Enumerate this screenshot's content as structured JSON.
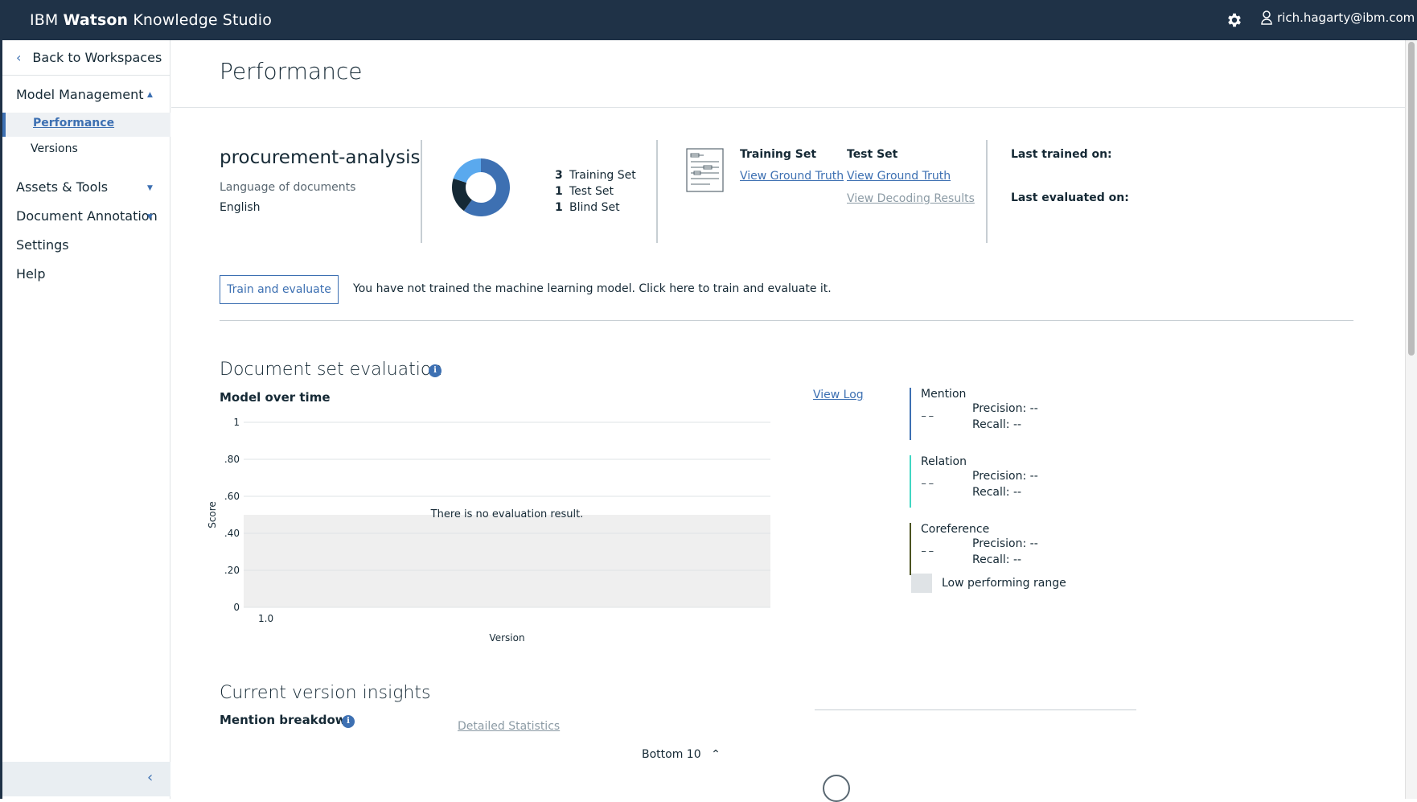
{
  "app": {
    "brand_prefix": "IBM",
    "brand_bold": "Watson",
    "brand_suffix": "Knowledge Studio",
    "user_email": "rich.hagarty@ibm.com"
  },
  "sidebar": {
    "back_label": "Back to Workspaces",
    "items": [
      {
        "label": "Model Management",
        "expanded": true
      },
      {
        "label": "Assets & Tools",
        "expanded": false
      },
      {
        "label": "Document Annotation",
        "expanded": false
      },
      {
        "label": "Settings"
      },
      {
        "label": "Help"
      }
    ],
    "subitems": [
      {
        "label": "Performance",
        "active": true
      },
      {
        "label": "Versions",
        "active": false
      }
    ]
  },
  "page": {
    "title": "Performance"
  },
  "project": {
    "name": "procurement-analysis",
    "language_label": "Language of documents",
    "language_value": "English"
  },
  "sets": {
    "training": {
      "count": "3",
      "label": "Training Set"
    },
    "test": {
      "count": "1",
      "label": "Test Set"
    },
    "blind": {
      "count": "1",
      "label": "Blind Set"
    },
    "donut_colors": [
      "#3d70b2",
      "#152935",
      "#5aa9ee"
    ]
  },
  "ground_truth": {
    "training_head": "Training Set",
    "training_link": "View Ground Truth",
    "test_head": "Test Set",
    "test_link": "View Ground Truth",
    "decoding_link": "View Decoding Results"
  },
  "status": {
    "last_trained": "Last trained on:",
    "last_evaluated": "Last evaluated on:"
  },
  "train": {
    "button": "Train and evaluate",
    "message": "You have not trained the machine learning model. Click here to train and evaluate it."
  },
  "evaluation": {
    "title": "Document set evaluation",
    "subtitle": "Model over time",
    "view_log": "View Log",
    "no_result": "There is no evaluation result."
  },
  "chart_data": {
    "type": "line",
    "xlabel": "Version",
    "ylabel": "Score",
    "x": [
      "1.0"
    ],
    "ylim": [
      0,
      1
    ],
    "yticks": [
      "0",
      ".20",
      ".40",
      ".60",
      ".80",
      "1"
    ],
    "ytick_values": [
      0,
      0.2,
      0.4,
      0.6,
      0.8,
      1
    ],
    "low_performing_range": [
      0,
      0.5
    ],
    "grid": true,
    "series": []
  },
  "metrics": [
    {
      "name": "Mention",
      "value": "--",
      "precision_label": "Precision:",
      "precision": "--",
      "recall_label": "Recall:",
      "recall": "--",
      "color": "#3d70b2"
    },
    {
      "name": "Relation",
      "value": "--",
      "precision_label": "Precision:",
      "precision": "--",
      "recall_label": "Recall:",
      "recall": "--",
      "color": "#41d6c3"
    },
    {
      "name": "Coreference",
      "value": "--",
      "precision_label": "Precision:",
      "precision": "--",
      "recall_label": "Recall:",
      "recall": "--",
      "color": "#4b5320"
    }
  ],
  "legend": {
    "low_range": "Low performing range"
  },
  "insights": {
    "title": "Current version insights",
    "mention_breakdown": "Mention breakdown",
    "detailed_stats": "Detailed Statistics",
    "bottom10": "Bottom 10"
  }
}
